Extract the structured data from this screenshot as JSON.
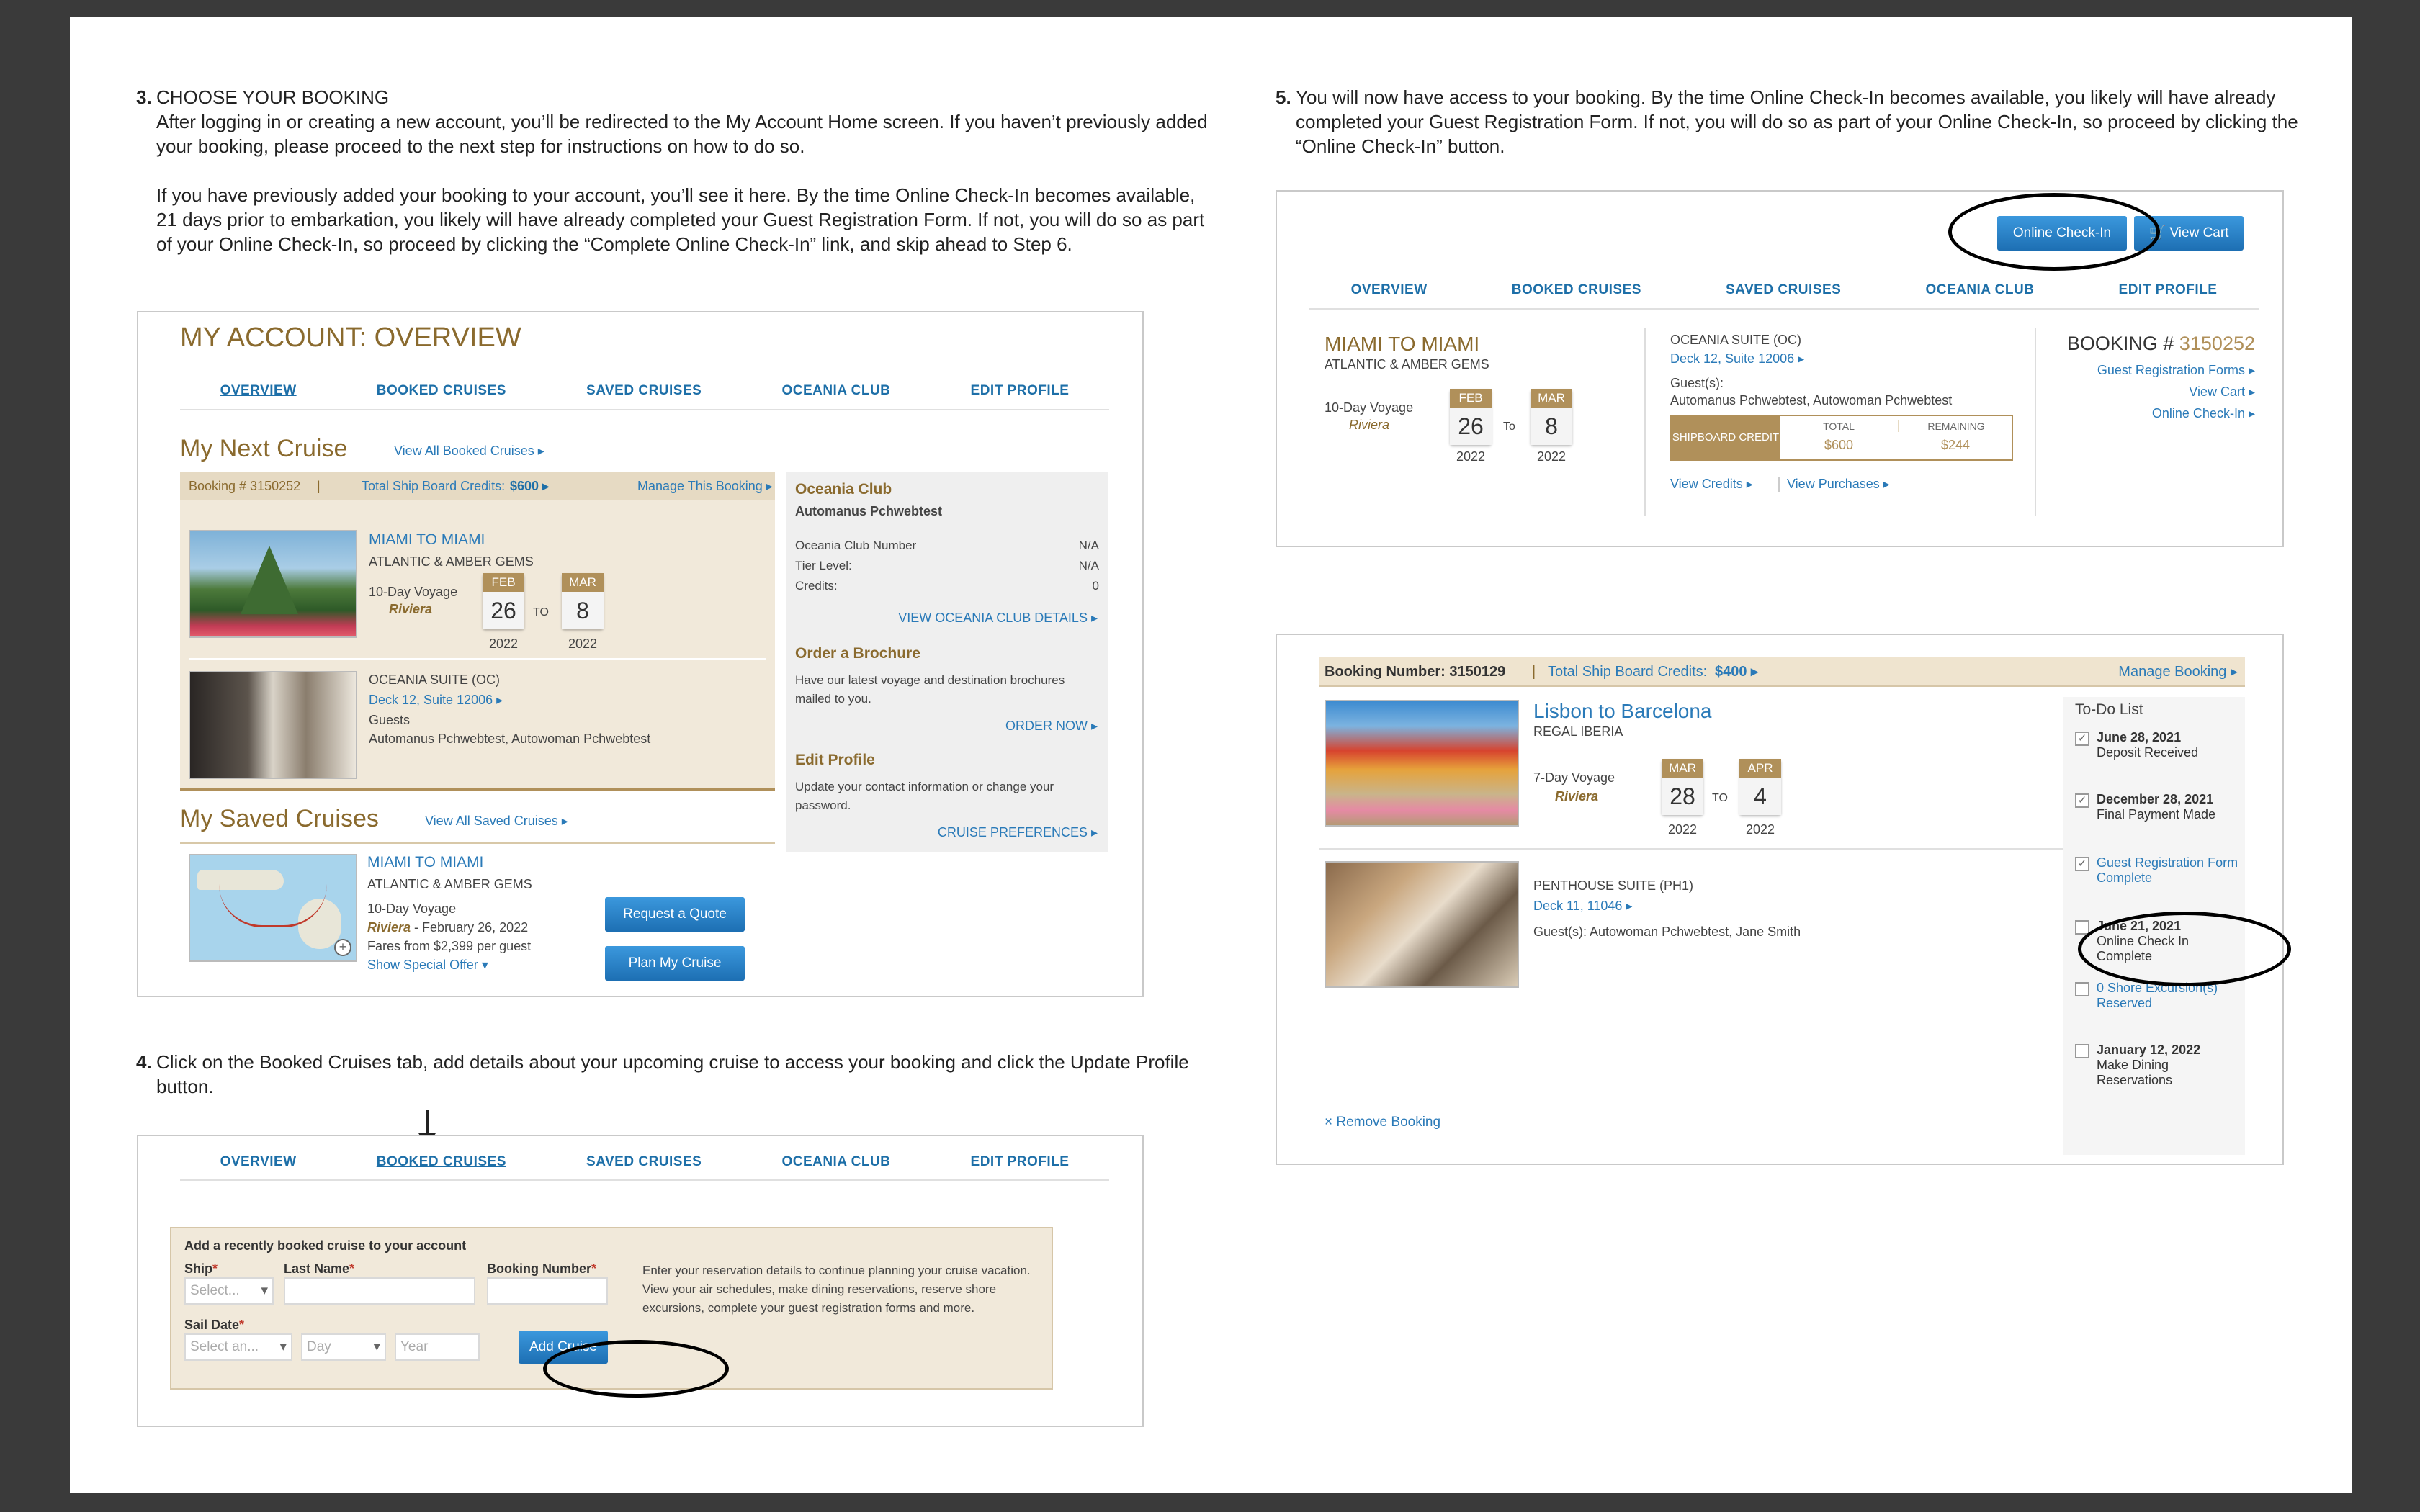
{
  "step3": {
    "num": "3.",
    "heading": "CHOOSE YOUR BOOKING",
    "para1": "After logging in or creating a new account, you’ll be redirected to the My Account Home screen. If you haven’t previously added your booking, please proceed to the next step for instructions on how to do so.",
    "para2": "If you have previously added your booking to your account, you’ll see it here. By the time Online Check-In becomes available, 21 days prior to embarkation, you likely will have already completed your Guest Registration Form. If not, you will do so as part of your Online Check-In, so proceed by clicking the “Complete Online Check-In” link, and skip ahead to Step 6."
  },
  "step4": {
    "num": "4.",
    "text": "Click on the Booked Cruises tab, add details about your upcoming cruise to access your booking and click the Update Profile button."
  },
  "step5": {
    "num": "5.",
    "text": "You will now have access to your booking. By the time Online Check-In becomes available, you likely will have already completed your Guest Registration Form. If not, you will do so as part of your Online Check-In, so proceed by clicking the “Online Check-In” button."
  },
  "nav": {
    "overview": "OVERVIEW",
    "booked": "BOOKED CRUISES",
    "saved": "SAVED CRUISES",
    "club": "OCEANIA CLUB",
    "edit": "EDIT PROFILE"
  },
  "account": {
    "title": "MY ACCOUNT: OVERVIEW",
    "next_title": "My Next Cruise",
    "view_all_booked": "View All Booked Cruises ▸",
    "booking_num": "Booking # 3150252",
    "sep": "|",
    "credits_label": "Total Ship Board Credits:",
    "credits_value": "$600 ▸",
    "manage": "Manage This Booking ▸",
    "route": "MIAMI TO MIAMI",
    "theme": "ATLANTIC & AMBER GEMS",
    "voyage": "10-Day Voyage",
    "ship": "Riviera",
    "start_mo": "FEB",
    "start_dy": "26",
    "start_yr": "2022",
    "to": "TO",
    "end_mo": "MAR",
    "end_dy": "8",
    "end_yr": "2022",
    "suite": "OCEANIA SUITE (OC)",
    "deck": "Deck 12, Suite 12006 ▸",
    "guests_label": "Guests",
    "guests": "Automanus Pchwebtest, Autowoman Pchwebtest",
    "club_title": "Oceania Club",
    "club_name": "Automanus Pchwebtest",
    "club_number_label": "Oceania Club Number",
    "club_number": "N/A",
    "tier_label": "Tier Level:",
    "tier": "N/A",
    "credits2_label": "Credits:",
    "credits2": "0",
    "club_link": "VIEW OCEANIA CLUB DETAILS ▸",
    "brochure_title": "Order a Brochure",
    "brochure_text": "Have our latest voyage and destination brochures mailed to you.",
    "order_now": "ORDER NOW ▸",
    "edit_title": "Edit Profile",
    "edit_text": "Update your contact information or change your password.",
    "prefs": "CRUISE PREFERENCES ▸",
    "saved_title": "My Saved Cruises",
    "view_all_saved": "View All Saved Cruises ▸",
    "saved_route": "MIAMI TO MIAMI",
    "saved_theme": "ATLANTIC & AMBER GEMS",
    "saved_voyage": "10-Day Voyage",
    "saved_ship": "Riviera",
    "saved_date": " - February 26, 2022",
    "saved_fares": "Fares from $2,399 per guest",
    "special": "Show Special Offer ▾",
    "quote_btn": "Request a Quote",
    "plan_btn": "Plan My Cruise"
  },
  "addcruise": {
    "title": "Add a recently booked cruise to your account",
    "ship_label": "Ship",
    "last_label": "Last Name",
    "booking_label": "Booking Number",
    "req": "*",
    "ship_ph": "Select...",
    "sail_label": "Sail Date",
    "sail_ph": "Select an...",
    "day_ph": "Day",
    "year_ph": "Year",
    "add_btn": "Add Cruise",
    "info": "Enter your reservation details to continue planning your cruise vacation. View your air schedules, make dining reservations, reserve shore excursions, complete your guest registration forms and more."
  },
  "checkin": {
    "online_btn": "Online Check-In",
    "cart_btn": "View Cart",
    "route": "MIAMI TO MIAMI",
    "theme": "ATLANTIC & AMBER GEMS",
    "voyage": "10-Day Voyage",
    "ship": "Riviera",
    "start_mo": "FEB",
    "start_dy": "26",
    "start_yr": "2022",
    "to": "To",
    "end_mo": "MAR",
    "end_dy": "8",
    "end_yr": "2022",
    "suite": "OCEANIA SUITE (OC)",
    "deck": "Deck 12, Suite 12006 ▸",
    "guests_label": "Guest(s):",
    "guests": "Automanus Pchwebtest, Autowoman Pchwebtest",
    "sbc": "SHIPBOARD CREDIT",
    "total_label": "TOTAL",
    "total": "$600",
    "remaining_label": "REMAINING",
    "remaining": "$244",
    "view_credits": "View Credits ▸",
    "view_purchases": "View Purchases ▸",
    "booking_label": "BOOKING #",
    "booking_num": "3150252",
    "link1": "Guest Registration Forms ▸",
    "link2": "View Cart ▸",
    "link3": "Online Check-In ▸"
  },
  "booking2": {
    "label": "Booking Number: 3150129",
    "sep": "|",
    "credits_label": "Total Ship Board Credits:",
    "credits": "$400 ▸",
    "manage": "Manage Booking ▸",
    "route": "Lisbon to Barcelona",
    "theme": "REGAL IBERIA",
    "voyage": "7-Day Voyage",
    "ship": "Riviera",
    "start_mo": "MAR",
    "start_dy": "28",
    "start_yr": "2022",
    "to": "TO",
    "end_mo": "APR",
    "end_dy": "4",
    "end_yr": "2022",
    "suite": "PENTHOUSE SUITE (PH1)",
    "deck": "Deck 11, 11046 ▸",
    "guests_label": "Guest(s):",
    "guests": "Autowoman Pchwebtest, Jane Smith",
    "remove": "× Remove Booking",
    "todo_title": "To-Do List",
    "todo": [
      {
        "date": "June 28, 2021",
        "text": "Deposit Received",
        "check": "✓"
      },
      {
        "date": "December 28, 2021",
        "text": "Final Payment Made",
        "check": "✓"
      },
      {
        "date": "Guest Registration Form",
        "text": "Complete",
        "check": "✓"
      },
      {
        "date": "June 21, 2021",
        "text": "Online Check In Complete",
        "check": ""
      },
      {
        "date": "0 Shore Excursion(s)",
        "text": "Reserved",
        "check": ""
      },
      {
        "date": "January 12, 2022",
        "text": "Make Dining Reservations",
        "check": ""
      }
    ]
  }
}
